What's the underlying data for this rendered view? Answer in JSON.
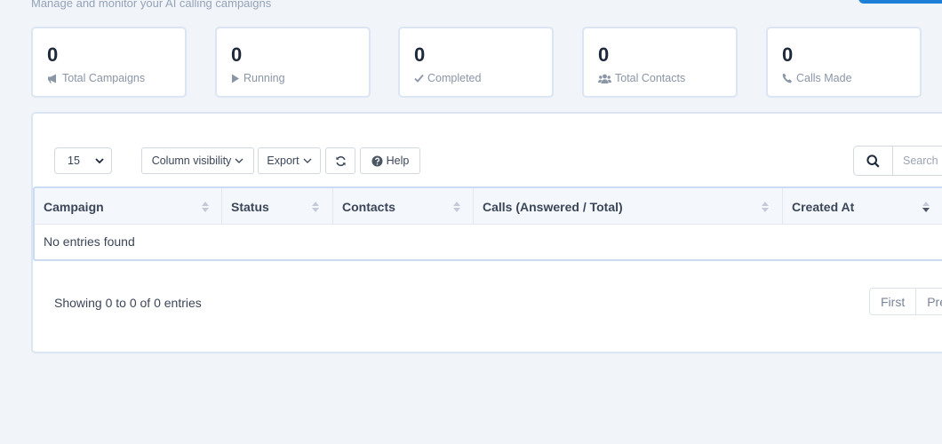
{
  "header": {
    "subtitle": "Manage and monitor your AI calling campaigns"
  },
  "stats": [
    {
      "value": "0",
      "label": "Total Campaigns",
      "icon": "bullhorn-icon"
    },
    {
      "value": "0",
      "label": "Running",
      "icon": "play-icon"
    },
    {
      "value": "0",
      "label": "Completed",
      "icon": "check-icon"
    },
    {
      "value": "0",
      "label": "Total Contacts",
      "icon": "users-icon"
    },
    {
      "value": "0",
      "label": "Calls Made",
      "icon": "phone-icon"
    }
  ],
  "toolbar": {
    "page_length": "15",
    "column_visibility_label": "Column visibility",
    "export_label": "Export",
    "help_label": "Help",
    "search_placeholder": "Search"
  },
  "table": {
    "columns": [
      "Campaign",
      "Status",
      "Contacts",
      "Calls (Answered / Total)",
      "Created At"
    ],
    "empty_text": "No entries found"
  },
  "footer": {
    "info": "Showing 0 to 0 of 0 entries",
    "pagination": [
      "First",
      "Pre"
    ]
  },
  "colors": {
    "background": "#f1f4f9",
    "accent": "#1d7fd6",
    "border": "#dbe5f3"
  }
}
